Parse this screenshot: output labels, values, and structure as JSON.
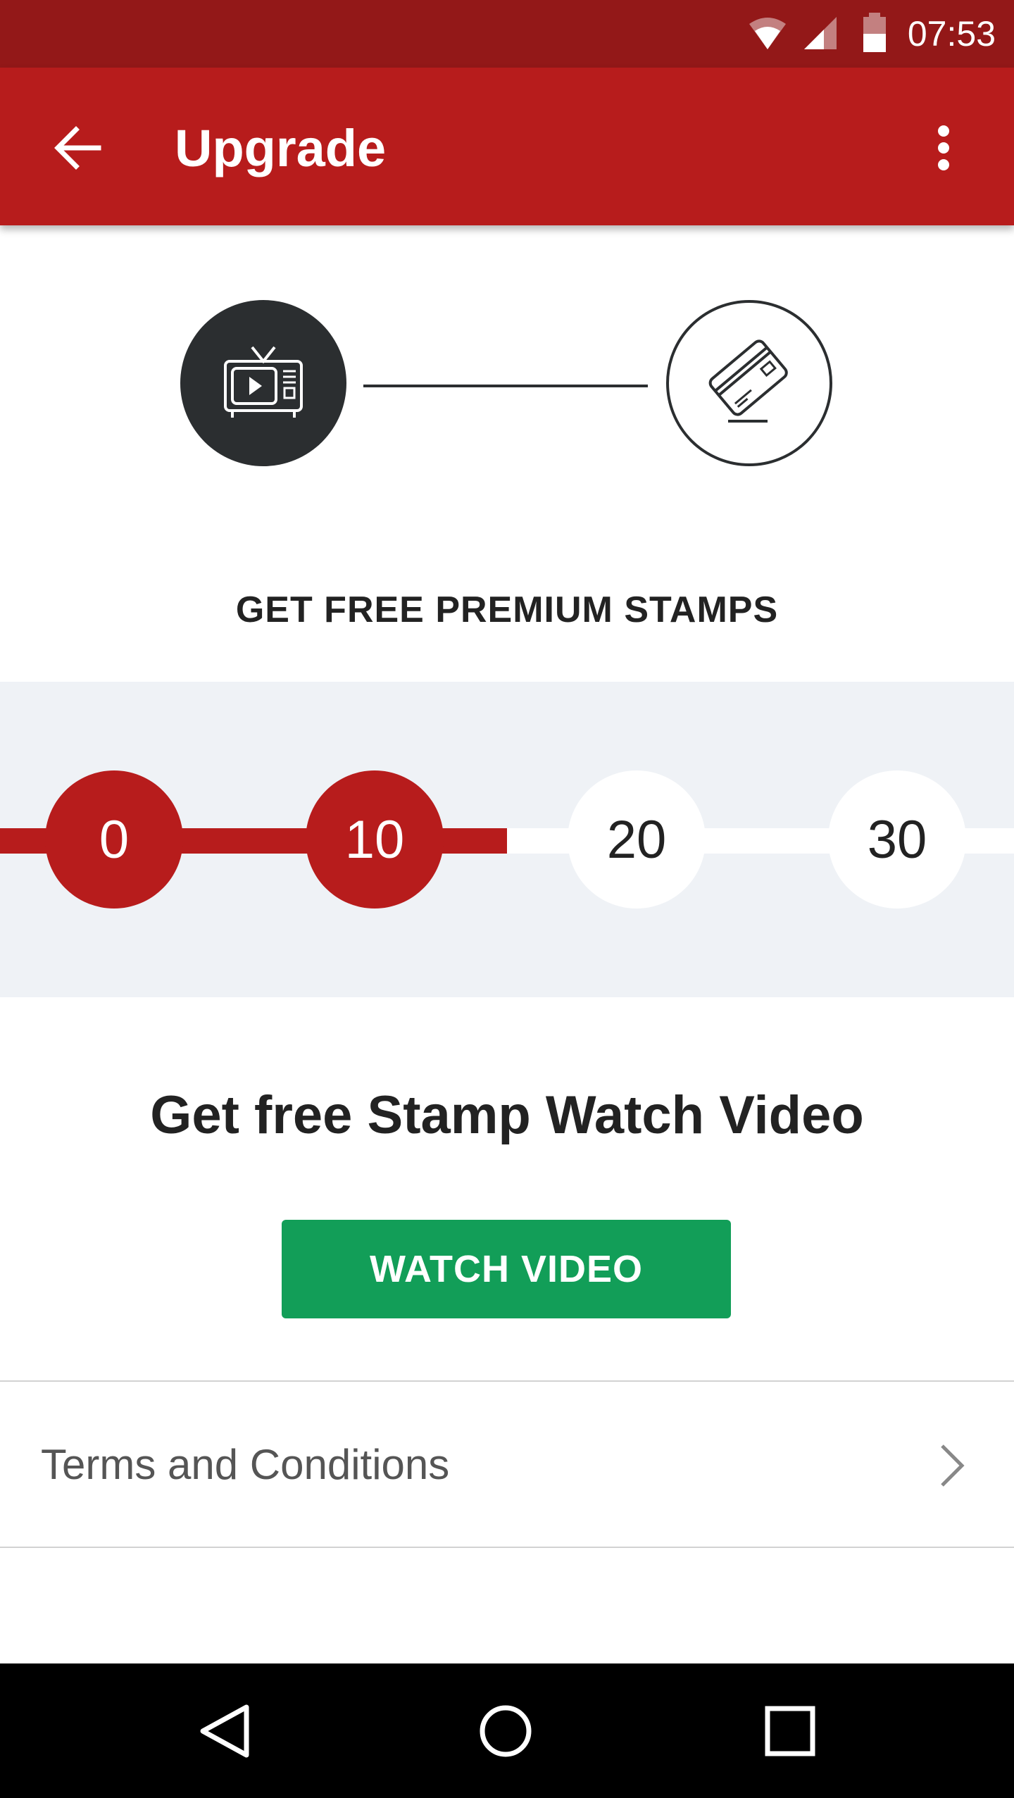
{
  "status_bar": {
    "time": "07:53"
  },
  "app_bar": {
    "title": "Upgrade"
  },
  "steps": {
    "step1_icon": "tv-video-icon",
    "step2_icon": "credit-card-icon"
  },
  "promo": {
    "heading": "GET FREE PREMIUM STAMPS"
  },
  "progress": {
    "milestones": [
      "0",
      "10",
      "20",
      "30"
    ],
    "completed": 2,
    "fill_percent": 50,
    "colors": {
      "done": "#b71c1c",
      "todo": "#ffffff",
      "band": "#eff2f6"
    }
  },
  "cta": {
    "heading": "Get free Stamp Watch Video",
    "button_label": "WATCH VIDEO",
    "button_color": "#129e58"
  },
  "terms": {
    "label": "Terms and Conditions"
  },
  "colors": {
    "status_bar": "#931818",
    "app_bar": "#b71c1c"
  }
}
